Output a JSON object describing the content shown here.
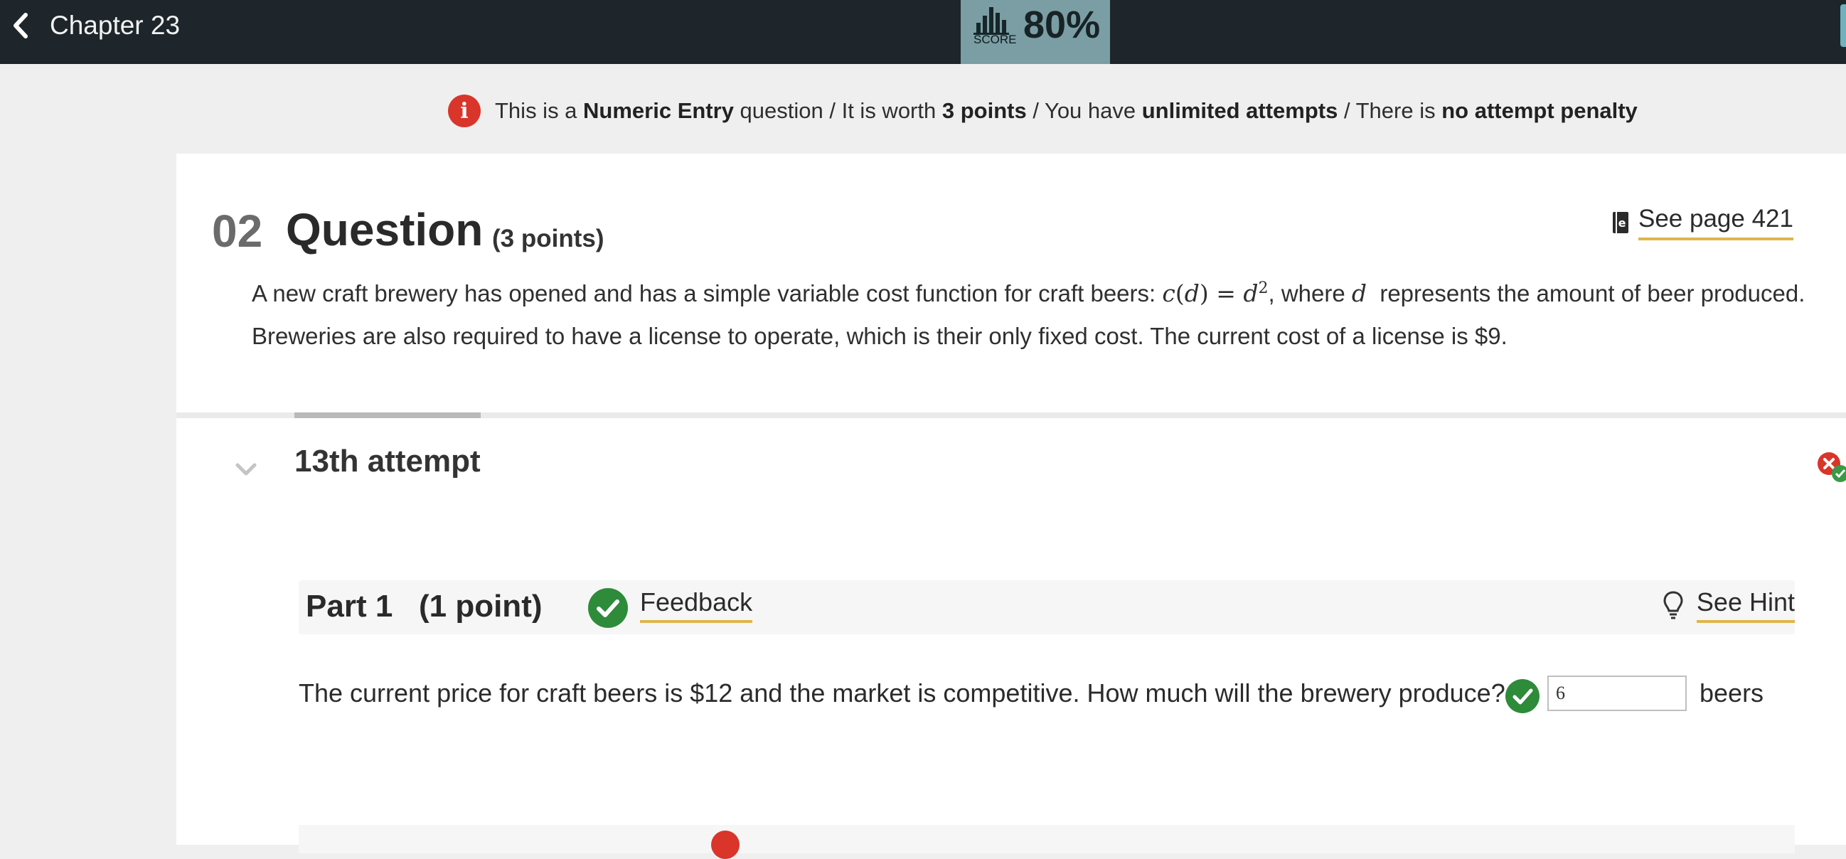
{
  "header": {
    "back_label": "Chapter 23",
    "score_caption": "SCORE",
    "score_value": "80%"
  },
  "info": {
    "p1": "This is a ",
    "type": "Numeric Entry",
    "p2": " question / It is worth ",
    "points": "3 points",
    "p3": " / You have ",
    "attempts": "unlimited attempts",
    "p4": " / There is ",
    "penalty": "no attempt penalty"
  },
  "question": {
    "number": "02",
    "title": "Question",
    "points": "(3 points)",
    "see_page": "See page 421",
    "text_a": "A new craft brewery has opened and has a simple variable cost function for craft beers: ",
    "math_c": "c",
    "math_open": "(",
    "math_d": "d",
    "math_close": ")",
    "math_eq": " = ",
    "math_d2": "d",
    "math_exp": "2",
    "text_b": ", where ",
    "math_var": "d",
    "text_c": "  represents the amount of beer produced. Breweries are also required to have a license to operate, which is their only fixed cost. The current cost of a license is $9."
  },
  "attempt": {
    "title": "13th attempt",
    "part_label": "Part 1",
    "part_points": "(1 point)",
    "feedback_label": "Feedback",
    "hint_label": "See Hint",
    "prompt": "The current price for craft beers is $12  and the market is competitive. How much will the brewery produce?",
    "answer_value": "6",
    "unit": "beers"
  },
  "colors": {
    "topbar": "#1e262b",
    "score_bg": "#7a9ea4",
    "accent_underline": "#e0b54a",
    "success": "#2e8b3a",
    "error": "#d9352a"
  },
  "icons": [
    "chevron-left-icon",
    "bar-chart-icon",
    "info-icon",
    "book-icon",
    "chevron-down-icon",
    "status-icon",
    "check-circle-icon",
    "lightbulb-icon"
  ]
}
